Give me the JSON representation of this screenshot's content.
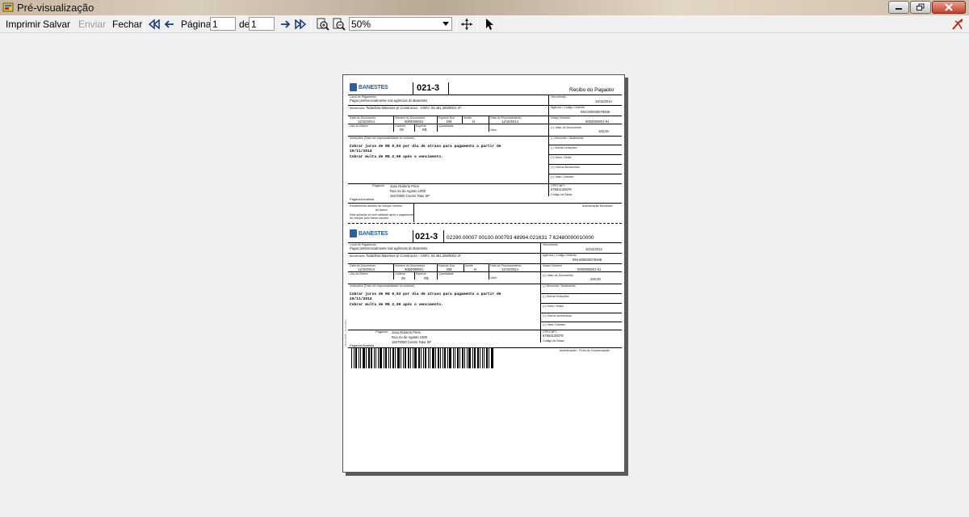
{
  "window": {
    "title": "Pré-visualização"
  },
  "toolbar": {
    "print_label": "Imprimir",
    "save_label": "Salvar",
    "send_label": "Enviar",
    "close_label": "Fechar",
    "page_label": "Página",
    "page_value": "1",
    "of_label": "de",
    "total_pages": "1",
    "zoom_value": "50%"
  },
  "document": {
    "receipt": {
      "bank_name": "BANESTES",
      "bank_code": "021-3",
      "title": "Recibo do Pagador",
      "local_pagamento_label": "Local de Pagamento",
      "local_pagamento_value": "Pagar preferencialmente nas agências do Banestes",
      "vencimento_label": "Vencimento",
      "vencimento_value": "10/11/2014",
      "beneficiario_label": "Beneficiário",
      "beneficiario_value": "TodaObra Materiais p/ Construcao - CNPJ: 03.481.209/0001-37",
      "agencia_label": "Agência / Código Cedente",
      "agencia_value": "094.000000079496",
      "data_documento_label": "Data do Documento",
      "data_documento_value": "12/10/2014",
      "numero_documento_label": "Numero do Documento",
      "numero_documento_value": "0000000001",
      "especie_doc_label": "Espécie Doc.",
      "especie_doc_value": "DM",
      "aceite_label": "Aceite",
      "aceite_value": "N",
      "data_processamento_label": "Data do Processamento",
      "data_processamento_value": "12/10/2014",
      "nosso_numero_label": "Nosso Número",
      "nosso_numero_value": "0000000001-91",
      "uso_banco_label": "Uso do Banco",
      "carteira_label": "Carteira",
      "carteira_value": "09",
      "especie_label": "Espécie",
      "especie_value": "R$",
      "quantidade_label": "Quantidade",
      "valor_label": "Valor",
      "valor_documento_label": "(=) Valor do Documento",
      "valor_documento_value": "100,00",
      "instrucoes_label": "Instruções (Texto de responsabilidade do cedente)",
      "instrucao_1": "Cobrar juros de R$ 0,03 por dia de atraso para pagamento a partir de",
      "instrucao_1b": "10/11/2014",
      "instrucao_2": "Cobrar multa de R$ 2,00 após o vencimento.",
      "desconto_label": "(-) Desconto / Abatimento",
      "outras_deducoes_label": "(-) Outras Deduções",
      "mora_multa_label": "(+) Mora / Multa",
      "outros_acrescimos_label": "(+) Outros Acréscimos",
      "valor_cobrado_label": "(=) Valor Cobrado",
      "pagador_label": "Pagador",
      "pagador_nome": "Joao Roberto Pires",
      "pagador_endereco": "Rua Xv de Agosto 1000",
      "pagador_cidade": "16270000 Centro Tatui SP",
      "pagador_avalista_label": "Pagador/Avalista",
      "cpf_label": "CPF/CNPJ",
      "cpf_value": "67564129379",
      "codigo_baixa_label": "Código de Baixa",
      "autenticacao_label": "Autenticação Mecânica",
      "recebimento_text": "Recebimento através do cheque número",
      "recebimento_text2": "do banco",
      "recebimento_text3": "Esta quitação só terá validade após o pagamento do cheque pelo banco sacado"
    },
    "slip": {
      "bank_name": "BANESTES",
      "bank_code": "021-3",
      "linha_digitavel": "02190.00007 00100.000793 48994.021631 7 62480000010000",
      "local_pagamento_label": "Local de Pagamento",
      "local_pagamento_value": "Pagar preferencialmente nas agências do Banestes",
      "vencimento_label": "Vencimento",
      "vencimento_value": "10/11/2014",
      "beneficiario_label": "Beneficiário",
      "beneficiario_value": "TodaObra Materiais p/ Construcao - CNPJ: 03.481.209/0001-37",
      "agencia_label": "Agência / Código Cedente",
      "agencia_value": "094.000000079496",
      "data_documento_label": "Data do Documento",
      "data_documento_value": "12/10/2014",
      "numero_documento_label": "Numero do Documento",
      "numero_documento_value": "0000000001",
      "especie_doc_label": "Espécie Doc.",
      "especie_doc_value": "DM",
      "aceite_label": "Aceite",
      "aceite_value": "N",
      "data_processamento_label": "Data do Processamento",
      "data_processamento_value": "12/10/2014",
      "nosso_numero_label": "Nosso Número",
      "nosso_numero_value": "0000000001-91",
      "uso_banco_label": "Uso do Banco",
      "carteira_label": "Carteira",
      "carteira_value": "09",
      "especie_label": "Espécie",
      "especie_value": "R$",
      "quantidade_label": "Quantidade",
      "valor_label": "Valor",
      "valor_documento_label": "(=) Valor do Documento",
      "valor_documento_value": "100,00",
      "instrucoes_label": "Instruções (Texto de responsabilidade do cedente)",
      "instrucao_1": "Cobrar juros de R$ 0,03 por dia de atraso para pagamento a partir de",
      "instrucao_1b": "10/11/2014",
      "instrucao_2": "Cobrar multa de R$ 2,00 após o vencimento.",
      "desconto_label": "(-) Desconto / Abatimento",
      "outras_deducoes_label": "(-) Outras Deduções",
      "mora_multa_label": "(+) Mora / Multa",
      "outros_acrescimos_label": "(+) Outros Acréscimos",
      "valor_cobrado_label": "(=) Valor Cobrado",
      "pagador_label": "Pagador",
      "pagador_nome": "Joao Roberto Pires",
      "pagador_endereco": "Rua Xv de Agosto 1000",
      "pagador_cidade": "16270000 Centro Tatui SP",
      "pagador_avalista_label": "Pagador/Avalista",
      "cpf_label": "CPF/CNPJ",
      "cpf_value": "67564129379",
      "codigo_baixa_label": "Código de Baixa",
      "autenticacao_label": "Autenticação - Ficha de Compensação",
      "side_text": "Ficha ICMS - 12.12.0014"
    }
  },
  "colors": {
    "brand_blue": "#2c5f9e",
    "close_red": "#c4402a"
  },
  "icons": {
    "app": "app-icon",
    "first": "first-page-icon",
    "prev": "prev-page-icon",
    "next": "next-page-icon",
    "last": "last-page-icon",
    "zoom_in": "zoom-in-icon",
    "zoom_out": "zoom-out-icon",
    "move": "move-icon",
    "pointer": "pointer-icon",
    "logo": "brand-logo-icon"
  }
}
